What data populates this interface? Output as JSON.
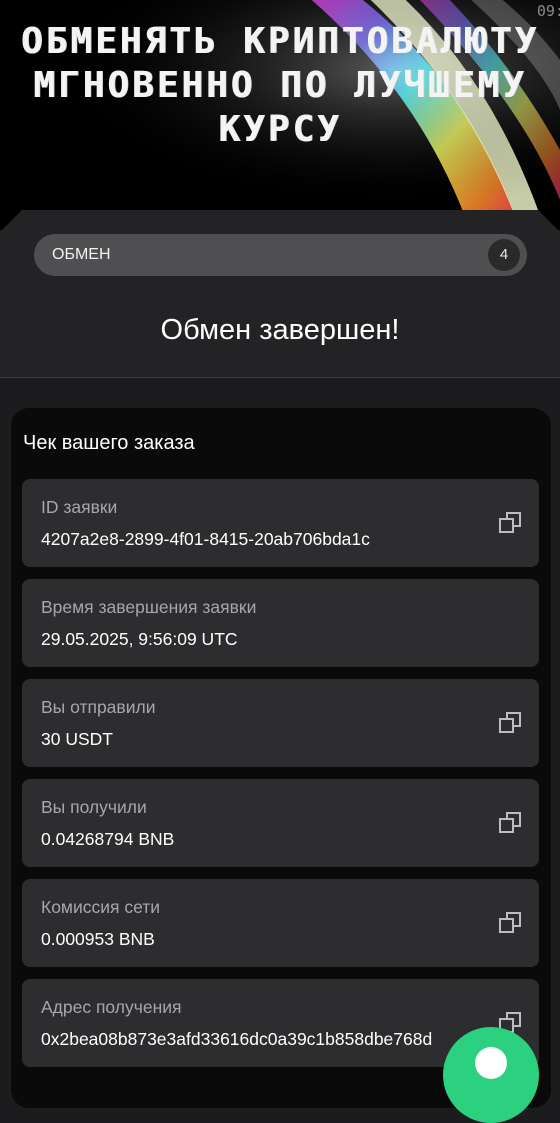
{
  "status_bar": {
    "time": "09:"
  },
  "hero": {
    "title": "ОБМЕНЯТЬ КРИПТОВАЛЮТУ МГНОВЕННО ПО ЛУЧШЕМУ КУРСУ"
  },
  "stepper": {
    "label": "ОБМЕН",
    "step": "4"
  },
  "status": {
    "title": "Обмен завершен!"
  },
  "receipt": {
    "title": "Чек вашего заказа",
    "rows": [
      {
        "label": "ID заявки",
        "value": "4207a2e8-2899-4f01-8415-20ab706bda1c",
        "copy_icon": "copy-icon"
      },
      {
        "label": "Время завершения заявки",
        "value": "29.05.2025, 9:56:09 UTC"
      },
      {
        "label": "Вы отправили",
        "value": "30 USDT",
        "copy_icon": "copy-icon"
      },
      {
        "label": "Вы получили",
        "value": "0.04268794 BNB",
        "copy_icon": "copy-icon"
      },
      {
        "label": "Комиссия сети",
        "value": "0.000953 BNB",
        "copy_icon": "copy-icon"
      },
      {
        "label": "Адрес получения",
        "value": "0x2bea08b873e3afd33616dc0a39c1b858dbe768d",
        "copy_icon": "copy-icon"
      }
    ]
  },
  "colors": {
    "background": "#1c1c1e",
    "card": "#2d2d2f",
    "receipt_bg": "#0a0a0a",
    "accent_green": "#2bd17e",
    "muted_text": "#a7a7ab"
  },
  "fab": {
    "icon": "chat-icon"
  }
}
